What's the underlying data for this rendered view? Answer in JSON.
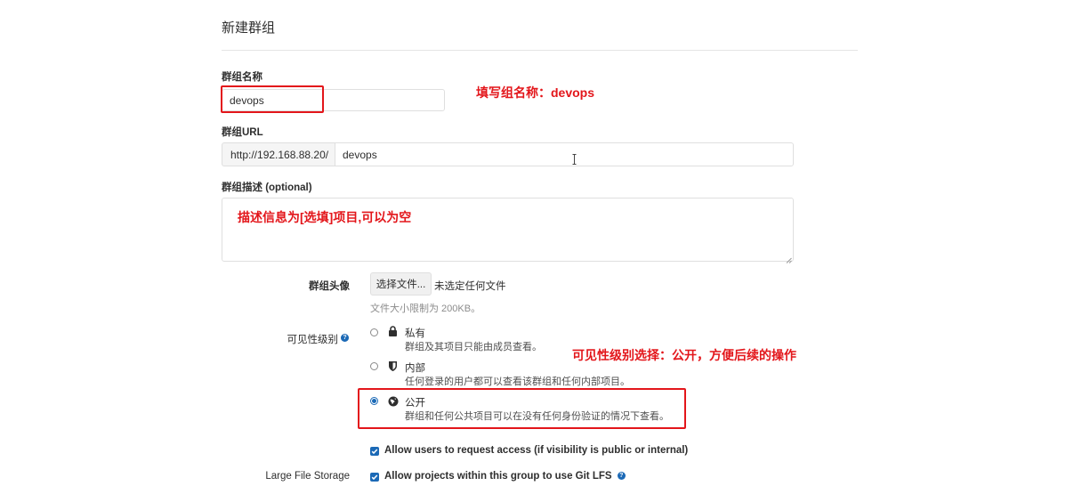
{
  "page": {
    "title": "新建群组"
  },
  "group_name": {
    "label": "群组名称",
    "value": "devops"
  },
  "group_url": {
    "label": "群组URL",
    "prefix": "http://192.168.88.20/",
    "value": "devops"
  },
  "group_description": {
    "label": "群组描述 (optional)",
    "value": ""
  },
  "avatar": {
    "label": "群组头像",
    "choose_button": "选择文件...",
    "no_file_text": "未选定任何文件",
    "size_hint": "文件大小限制为 200KB。"
  },
  "visibility": {
    "label": "可见性级别",
    "options": [
      {
        "title": "私有",
        "description": "群组及其项目只能由成员查看。",
        "icon": "lock-icon",
        "selected": false
      },
      {
        "title": "内部",
        "description": "任何登录的用户都可以查看该群组和任何内部项目。",
        "icon": "shield-icon",
        "selected": false
      },
      {
        "title": "公开",
        "description": "群组和任何公共项目可以在没有任何身份验证的情况下查看。",
        "icon": "globe-icon",
        "selected": true
      }
    ]
  },
  "access_request": {
    "label": "Allow users to request access (if visibility is public or internal)",
    "checked": true
  },
  "lfs": {
    "side_label": "Large File Storage",
    "label": "Allow projects within this group to use Git LFS",
    "checked": true
  },
  "annotations": {
    "name_note": "填写组名称：devops",
    "description_note": "描述信息为[选填]项目,可以为空",
    "visibility_note": "可见性级别选择：公开，方便后续的操作"
  },
  "colors": {
    "accent": "#1b69b6",
    "annotation": "#e3161b"
  }
}
